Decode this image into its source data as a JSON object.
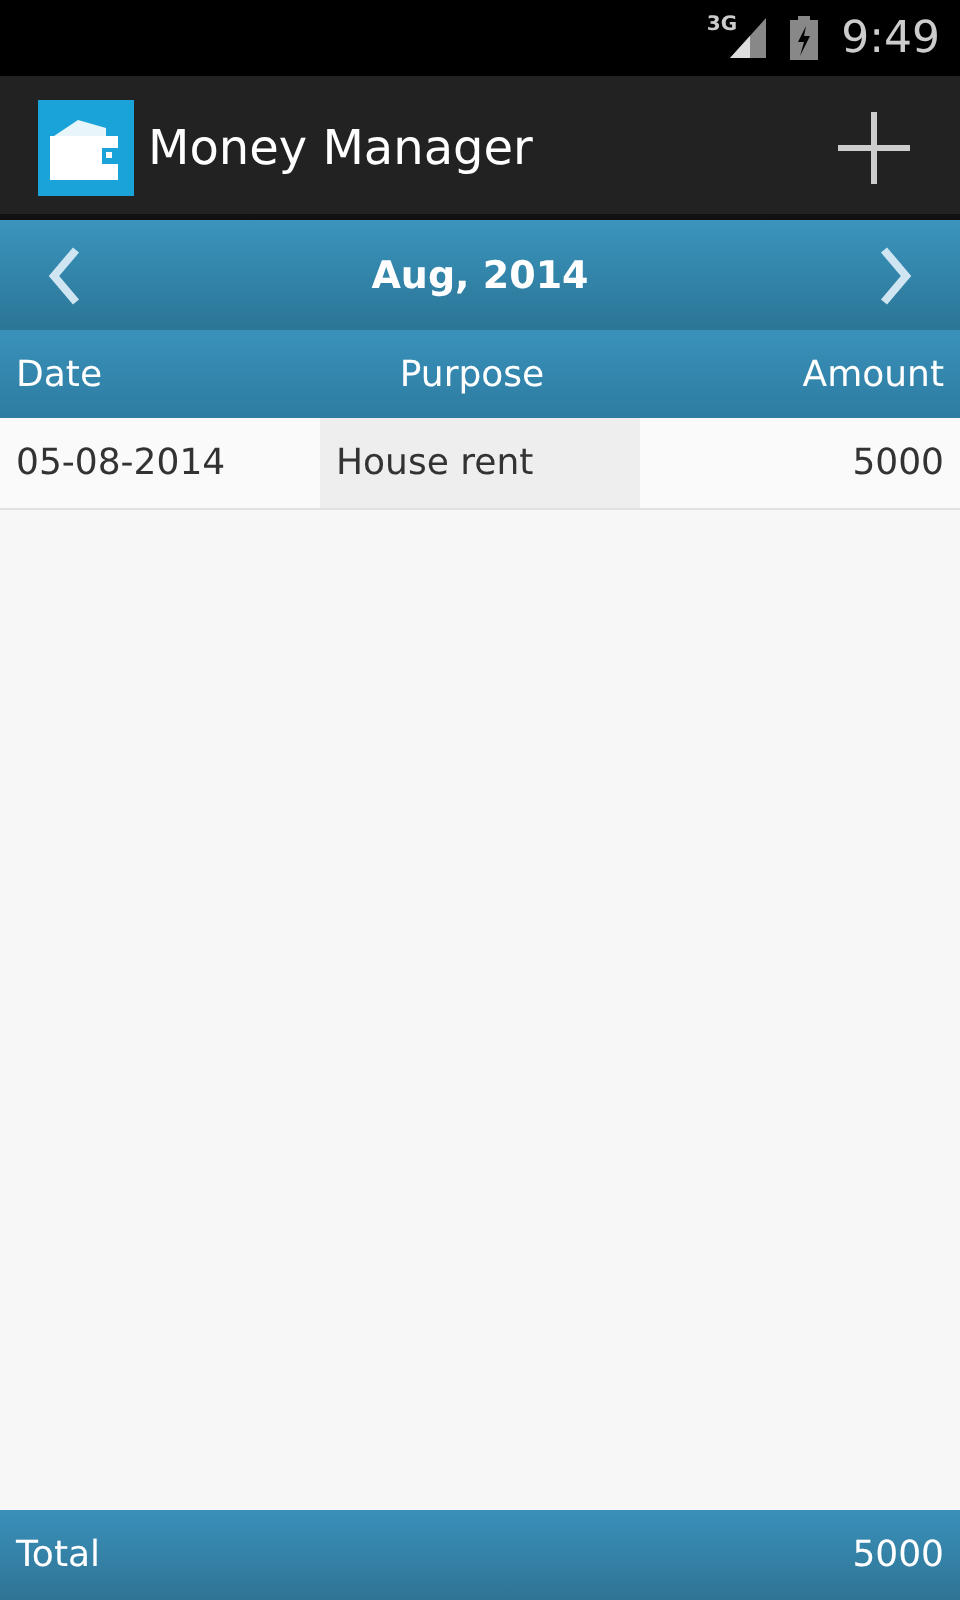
{
  "status_bar": {
    "network": "3G",
    "time": "9:49"
  },
  "app_bar": {
    "title": "Money Manager"
  },
  "month_nav": {
    "label": "Aug, 2014"
  },
  "table": {
    "columns": [
      "Date",
      "Purpose",
      "Amount"
    ],
    "rows": [
      {
        "cells": [
          {
            "text": "05-08-2014",
            "selected": false
          },
          {
            "text": "House rent",
            "selected": true
          },
          {
            "text": "5000",
            "selected": false
          }
        ]
      }
    ]
  },
  "footer": {
    "label": "Total",
    "value": "5000"
  }
}
